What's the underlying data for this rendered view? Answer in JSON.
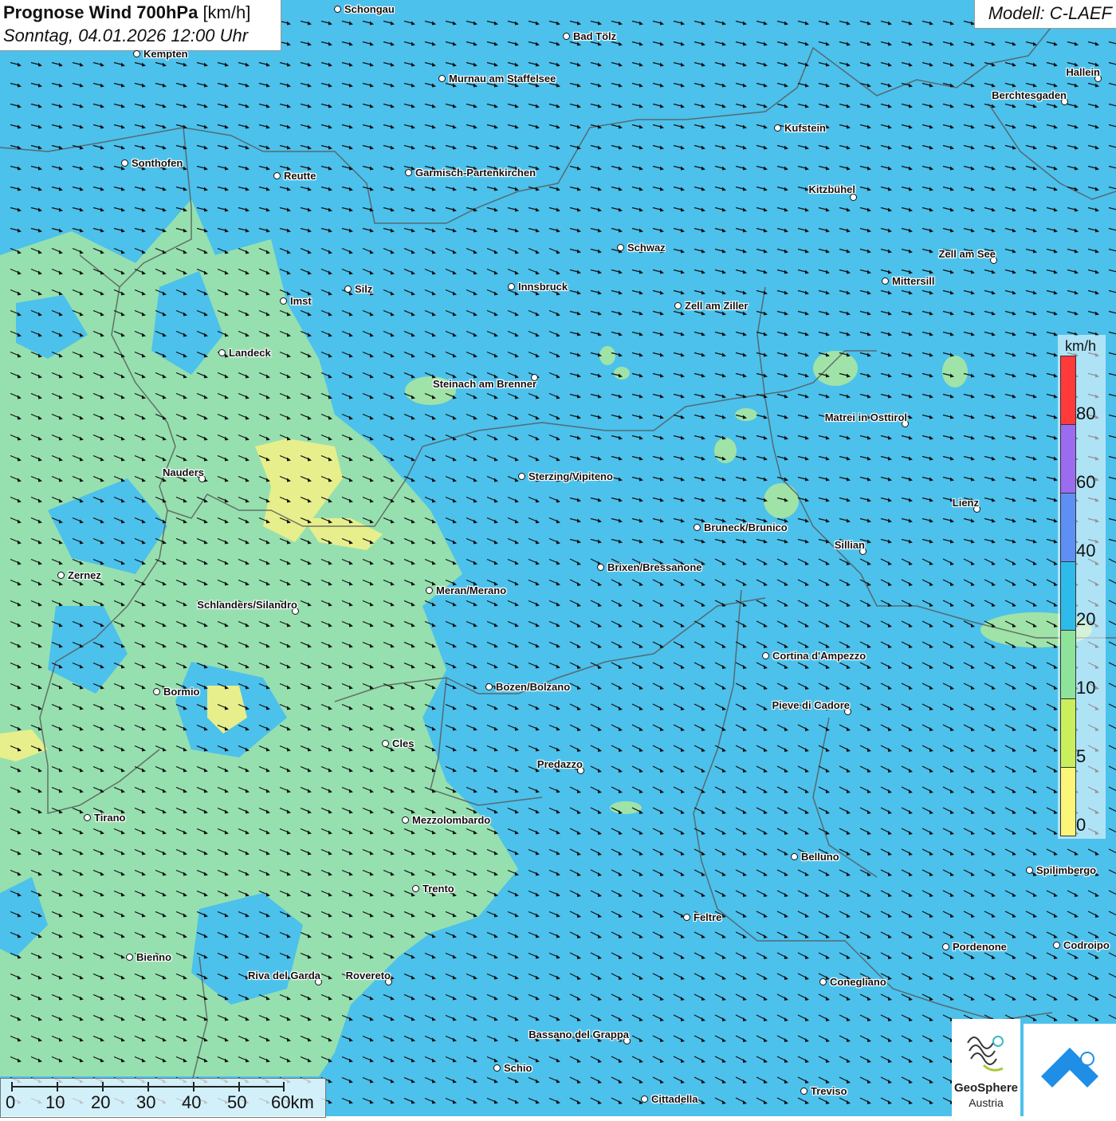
{
  "header": {
    "title_bold": "Prognose Wind 700hPa",
    "title_unit": "[km/h]",
    "datetime": "Sonntag, 04.01.2026 12:00 Uhr"
  },
  "model": {
    "label": "Modell: C-LAEF"
  },
  "legend": {
    "unit": "km/h",
    "ticks": [
      "80",
      "60",
      "40",
      "20",
      "10",
      "5",
      "0"
    ],
    "colors": [
      "#ff3a3a",
      "#9b6cf0",
      "#5e8ff5",
      "#2fbbe9",
      "#8ee39a",
      "#c9ef5c",
      "#fbf57a"
    ]
  },
  "scale_bar": {
    "labels": [
      "0",
      "10",
      "20",
      "30",
      "40",
      "50",
      "60km"
    ]
  },
  "branding": {
    "name_line1": "GeoSphere",
    "name_line2": "Austria"
  },
  "colors": {
    "sea_blue": "#4cc1ec",
    "green_zone": "#9fe3a8",
    "yellow_zone": "#e6ef8c",
    "border": "#555555"
  },
  "cities": [
    {
      "name": "Schongau"
    },
    {
      "name": "Bad Tölz"
    },
    {
      "name": "Kempten"
    },
    {
      "name": "Murnau am Staffelsee"
    },
    {
      "name": "Hallein"
    },
    {
      "name": "Berchtesgaden"
    },
    {
      "name": "Kufstein"
    },
    {
      "name": "Sonthofen"
    },
    {
      "name": "Reutte"
    },
    {
      "name": "Garmisch-Partenkirchen"
    },
    {
      "name": "Kitzbühel"
    },
    {
      "name": "Schwaz"
    },
    {
      "name": "Zell am See"
    },
    {
      "name": "Mittersill"
    },
    {
      "name": "Silz"
    },
    {
      "name": "Imst"
    },
    {
      "name": "Innsbruck"
    },
    {
      "name": "Zell am Ziller"
    },
    {
      "name": "Landeck"
    },
    {
      "name": "Steinach am Brenner"
    },
    {
      "name": "Matrei in Osttirol"
    },
    {
      "name": "Nauders"
    },
    {
      "name": "Sterzing/Vipiteno"
    },
    {
      "name": "Lienz"
    },
    {
      "name": "Bruneck/Brunico"
    },
    {
      "name": "Sillian"
    },
    {
      "name": "Zernez"
    },
    {
      "name": "Brixen/Bressanone"
    },
    {
      "name": "Meran/Merano"
    },
    {
      "name": "Schlanders/Silandro"
    },
    {
      "name": "Cortina d'Ampezzo"
    },
    {
      "name": "Bozen/Bolzano"
    },
    {
      "name": "Bormio"
    },
    {
      "name": "Pieve di Cadore"
    },
    {
      "name": "Cles"
    },
    {
      "name": "Predazzo"
    },
    {
      "name": "Tirano"
    },
    {
      "name": "Mezzolombardo"
    },
    {
      "name": "Belluno"
    },
    {
      "name": "Spilimbergo"
    },
    {
      "name": "Trento"
    },
    {
      "name": "Feltre"
    },
    {
      "name": "Pordenone"
    },
    {
      "name": "Codroipo"
    },
    {
      "name": "Bienno"
    },
    {
      "name": "Riva del Garda"
    },
    {
      "name": "Rovereto"
    },
    {
      "name": "Conegliano"
    },
    {
      "name": "Bassano del Grappa"
    },
    {
      "name": "Schio"
    },
    {
      "name": "Treviso"
    },
    {
      "name": "Cittadella"
    }
  ]
}
